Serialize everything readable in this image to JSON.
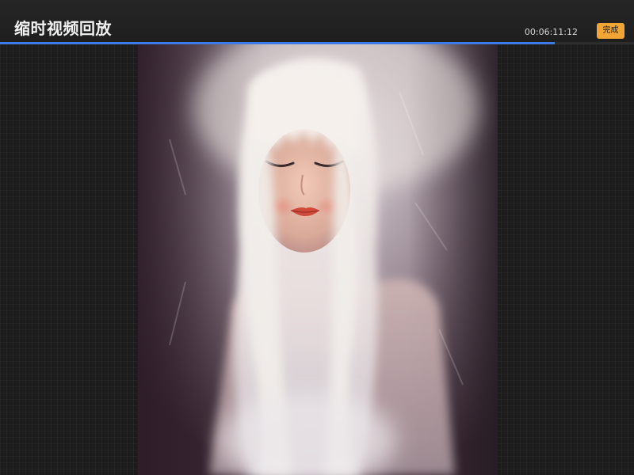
{
  "header": {
    "title": "缩时视频回放",
    "elapsed_time": "00:06:11:12",
    "done_label": "完成"
  },
  "playback": {
    "progress_fraction": 0.875
  },
  "colors": {
    "accent_progress": "#3d7be6",
    "done_button": "#f0a534",
    "background": "#1c1c1c"
  },
  "icons": []
}
